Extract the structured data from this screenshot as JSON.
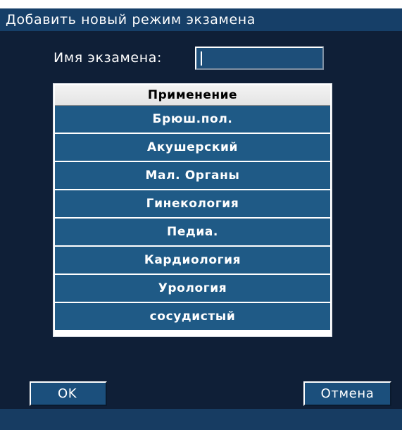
{
  "dialog": {
    "title": "Добавить новый режим экзамена",
    "name_label": "Имя экзамена:",
    "name_value": "",
    "colors": {
      "background": "#0f1f37",
      "title_bar": "#163f68",
      "row": "#1f5a86",
      "button": "#1b4f7c"
    }
  },
  "list": {
    "header": "Применение",
    "items": [
      "Брюш.пол.",
      "Акушерский",
      "Мал. Органы",
      "Гинекология",
      "Педиа.",
      "Кардиология",
      "Урология",
      "сосудистый"
    ]
  },
  "buttons": {
    "ok": "OK",
    "cancel": "Отмена"
  }
}
